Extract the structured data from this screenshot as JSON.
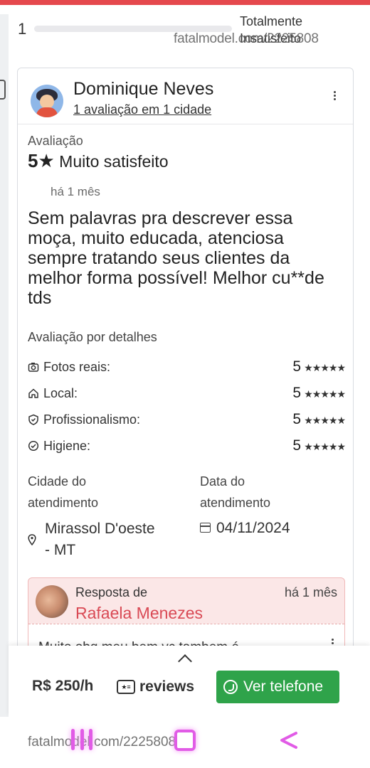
{
  "header": {
    "page_number": "1",
    "status_line1": "Totalmente",
    "status_line2": "Insatisfeito",
    "watermark": "fatalmodel.com/2225808"
  },
  "review": {
    "reviewer_name": "Dominique Neves",
    "reviewer_sub": "1 avaliação em 1 cidade",
    "rating_label": "Avaliação",
    "rating_score": "5★",
    "rating_text": "Muito satisfeito",
    "time_ago": "há 1 mês",
    "text": "Sem palavras pra descrever essa moça, muito educada, atenciosa sempre tratando seus clientes da melhor forma possível! Melhor cu**de tds"
  },
  "details": {
    "title": "Avaliação por detalhes",
    "items": [
      {
        "label": "Fotos reais:",
        "score": "5",
        "stars": "★★★★★",
        "icon": "camera-icon"
      },
      {
        "label": "Local:",
        "score": "5",
        "stars": "★★★★★",
        "icon": "home-icon"
      },
      {
        "label": "Profissionalismo:",
        "score": "5",
        "stars": "★★★★★",
        "icon": "shield-icon"
      },
      {
        "label": "Higiene:",
        "score": "5",
        "stars": "★★★★★",
        "icon": "check-circle-icon"
      }
    ]
  },
  "meta": {
    "city_label_line1": "Cidade do",
    "city_label_line2": "atendimento",
    "city_line1": "Mirassol D'oeste",
    "city_line2": "- MT",
    "date_label_line1": "Data do",
    "date_label_line2": "atendimento",
    "date": "04/11/2024"
  },
  "reply": {
    "label": "Resposta de",
    "time": "há 1 mês",
    "name": "Rafaela Menezes",
    "text": "Muito obg meu bem vc tambem é"
  },
  "bottom_bar": {
    "price": "R$ 250/h",
    "reviews_label": "reviews",
    "whatsapp_label": "Ver telefone"
  },
  "colors": {
    "accent_red": "#e5484d",
    "whatsapp_green": "#2fa34a",
    "reply_name": "#d94a55",
    "nav_glow": "#e15be6"
  }
}
